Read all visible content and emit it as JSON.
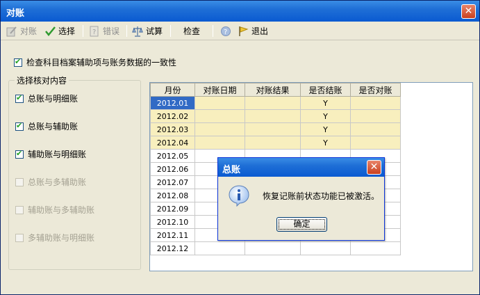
{
  "window": {
    "title": "对账"
  },
  "toolbar": {
    "items": [
      {
        "label": "对账",
        "icon": "check-pencil-icon",
        "enabled": false
      },
      {
        "label": "选择",
        "icon": "checkmark-icon",
        "enabled": true
      },
      {
        "label": "错误",
        "icon": "error-doc-icon",
        "enabled": false
      },
      {
        "label": "试算",
        "icon": "scale-icon",
        "enabled": true
      },
      {
        "label": "检查",
        "icon": "",
        "enabled": true
      },
      {
        "label": "",
        "icon": "help-icon",
        "enabled": false
      },
      {
        "label": "退出",
        "icon": "exit-flag-icon",
        "enabled": true
      }
    ]
  },
  "consistency_check": {
    "label": "检查科目档案辅助项与账务数据的一致性",
    "checked": true
  },
  "options_group": {
    "title": "选择核对内容",
    "options": [
      {
        "label": "总账与明细账",
        "checked": true,
        "enabled": true
      },
      {
        "label": "总账与辅助账",
        "checked": true,
        "enabled": true
      },
      {
        "label": "辅助账与明细账",
        "checked": true,
        "enabled": true
      },
      {
        "label": "总账与多辅助账",
        "checked": false,
        "enabled": false
      },
      {
        "label": "辅助账与多辅助账",
        "checked": false,
        "enabled": false
      },
      {
        "label": "多辅助账与明细账",
        "checked": false,
        "enabled": false
      }
    ]
  },
  "grid": {
    "columns": [
      "月份",
      "对账日期",
      "对账结果",
      "是否结账",
      "是否对账"
    ],
    "rows": [
      [
        "2012.01",
        "",
        "",
        "Y",
        ""
      ],
      [
        "2012.02",
        "",
        "",
        "Y",
        ""
      ],
      [
        "2012.03",
        "",
        "",
        "Y",
        ""
      ],
      [
        "2012.04",
        "",
        "",
        "Y",
        ""
      ],
      [
        "2012.05",
        "",
        "",
        "",
        ""
      ],
      [
        "2012.06",
        "",
        "",
        "",
        ""
      ],
      [
        "2012.07",
        "",
        "",
        "",
        ""
      ],
      [
        "2012.08",
        "",
        "",
        "",
        ""
      ],
      [
        "2012.09",
        "",
        "",
        "",
        ""
      ],
      [
        "2012.10",
        "",
        "",
        "",
        ""
      ],
      [
        "2012.11",
        "",
        "",
        "",
        ""
      ],
      [
        "2012.12",
        "",
        "",
        "",
        ""
      ]
    ],
    "highlight_color": "#f8efbe",
    "selected_color": "#316ac5"
  },
  "dialog": {
    "title": "总账",
    "message": "恢复记账前状态功能已被激活。",
    "ok_label": "确定",
    "icon": "info-icon"
  }
}
